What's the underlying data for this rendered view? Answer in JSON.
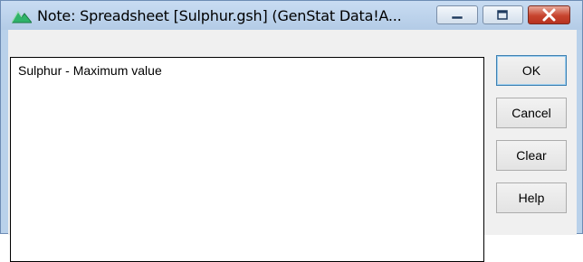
{
  "window": {
    "title": "Note: Spreadsheet [Sulphur.gsh] (GenStat Data!A...",
    "icons": {
      "app": "genstat-app-icon",
      "minimize": "minimize-icon",
      "maximize": "maximize-icon",
      "close": "close-icon"
    }
  },
  "note": {
    "text": "Sulphur - Maximum value"
  },
  "buttons": {
    "ok": "OK",
    "cancel": "Cancel",
    "clear": "Clear",
    "help": "Help"
  }
}
